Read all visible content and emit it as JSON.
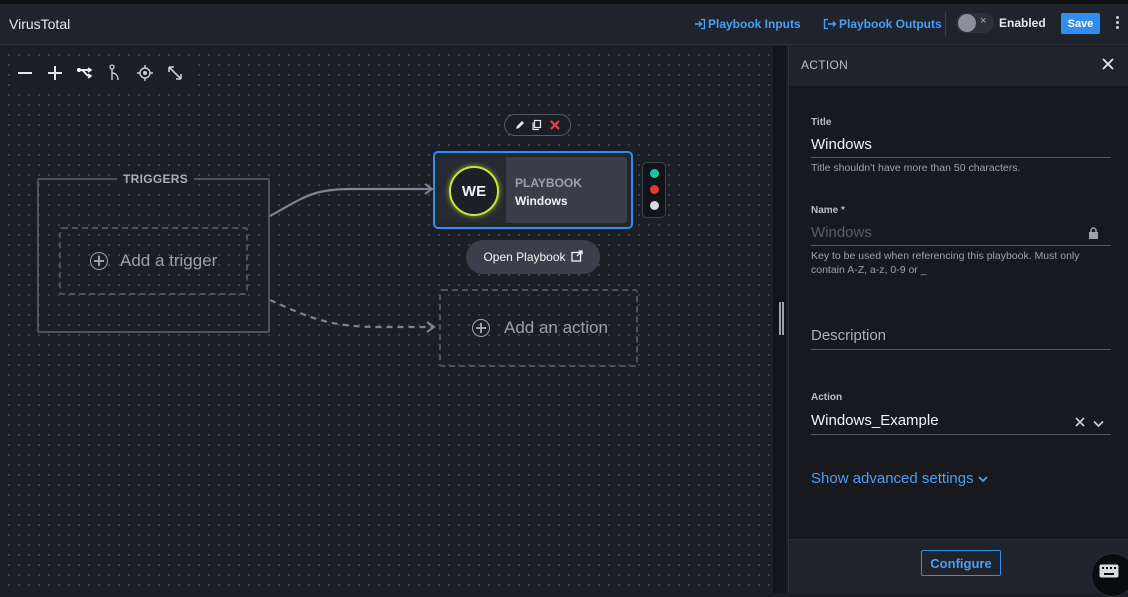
{
  "app": {
    "title": "VirusTotal"
  },
  "topbar": {
    "playbook_inputs": "Playbook Inputs",
    "playbook_outputs": "Playbook Outputs",
    "enabled_label": "Enabled",
    "toggle_icon": "×",
    "save_label": "Save"
  },
  "canvas": {
    "toolbar_icons": [
      "zoom-out-icon",
      "zoom-in-icon",
      "branch-icon",
      "fork-icon",
      "center-target-icon",
      "fit-screen-icon"
    ],
    "triggers_label": "TRIGGERS",
    "add_trigger": "Add a trigger",
    "add_action": "Add an action",
    "node": {
      "initials": "WE",
      "kind": "PLAYBOOK",
      "name": "Windows",
      "accent": "#c6e83a",
      "border": "#2f8ef0"
    },
    "ports": [
      "#19c7a8",
      "#e03b2b",
      "#d7dbe0"
    ],
    "open_playbook": "Open Playbook"
  },
  "panel": {
    "header": "ACTION",
    "title_label": "Title",
    "title_value": "Windows",
    "title_help": "Title shouldn't have more than 50 characters.",
    "name_label": "Name *",
    "name_value": "Windows",
    "name_help": "Key to be used when referencing this playbook. Must only contain A-Z, a-z, 0-9 or _",
    "description_label": "Description",
    "action_label": "Action",
    "action_value": "Windows_Example",
    "advanced": "Show advanced settings",
    "configure": "Configure"
  },
  "colors": {
    "accent_blue": "#2f8ef0",
    "link_blue": "#4a9ff5",
    "delete_red": "#e5413a"
  }
}
